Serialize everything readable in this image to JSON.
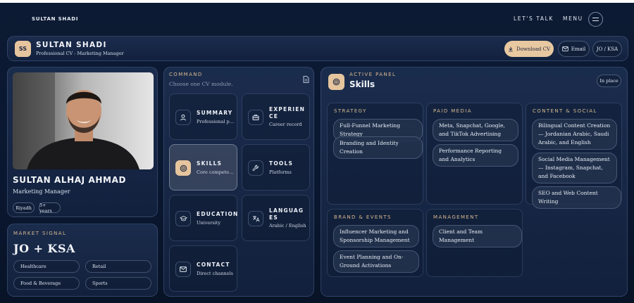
{
  "nav": {
    "brand": "SULTAN SHADI",
    "lets_talk": "LET'S TALK",
    "menu": "MENU"
  },
  "header": {
    "initials": "SS",
    "name": "SULTAN SHADI",
    "subtitle": "Professional CV - Marketing Manager",
    "download_label": "Download CV",
    "email_label": "Email",
    "lang_label": "JO / KSA"
  },
  "profile": {
    "name": "SULTAN ALHAJ AHMAD",
    "role": "Marketing Manager",
    "chips": [
      "Riyadh",
      "5+ years"
    ]
  },
  "market": {
    "label": "MARKET SIGNAL",
    "headline": "JO + KSA",
    "chips": [
      "Healthcare",
      "Retail",
      "Food & Beverage",
      "Sports"
    ]
  },
  "command": {
    "label": "COMMAND",
    "subtitle": "Choose one CV module.",
    "tiles": [
      {
        "title": "SUMMARY",
        "desc": "Professional pr..."
      },
      {
        "title": "EXPERIENCE",
        "desc": "Career record"
      },
      {
        "title": "SKILLS",
        "desc": "Core competen..."
      },
      {
        "title": "TOOLS",
        "desc": "Platforms"
      },
      {
        "title": "EDUCATION",
        "desc": "University"
      },
      {
        "title": "LANGUAGES",
        "desc": "Arabic / English"
      },
      {
        "title": "CONTACT",
        "desc": "Direct channels"
      }
    ]
  },
  "active_panel": {
    "label": "ACTIVE PANEL",
    "title": "Skills",
    "in_place_label": "In place",
    "categories": [
      {
        "label": "STRATEGY",
        "items": [
          "Full-Funnel Marketing Strategy",
          "Branding and Identity Creation"
        ]
      },
      {
        "label": "PAID MEDIA",
        "items": [
          "Meta, Snapchat, Google, and TikTok Advertising",
          "Performance Reporting and Analytics"
        ]
      },
      {
        "label": "CONTENT & SOCIAL",
        "items": [
          "Bilingual Content Creation — Jordanian Arabic, Saudi Arabic, and English",
          "Social Media Management — Instagram, Snapchat, and Facebook",
          "SEO and Web Content Writing"
        ]
      },
      {
        "label": "BRAND & EVENTS",
        "items": [
          "Influencer Marketing and Sponsorship Management",
          "Event Planning and On-Ground Activations"
        ]
      },
      {
        "label": "MANAGEMENT",
        "items": [
          "Client and Team Management"
        ]
      }
    ]
  },
  "colors": {
    "accent": "#e6c59e",
    "background": "#0c1a33",
    "label": "#d8b98f"
  }
}
